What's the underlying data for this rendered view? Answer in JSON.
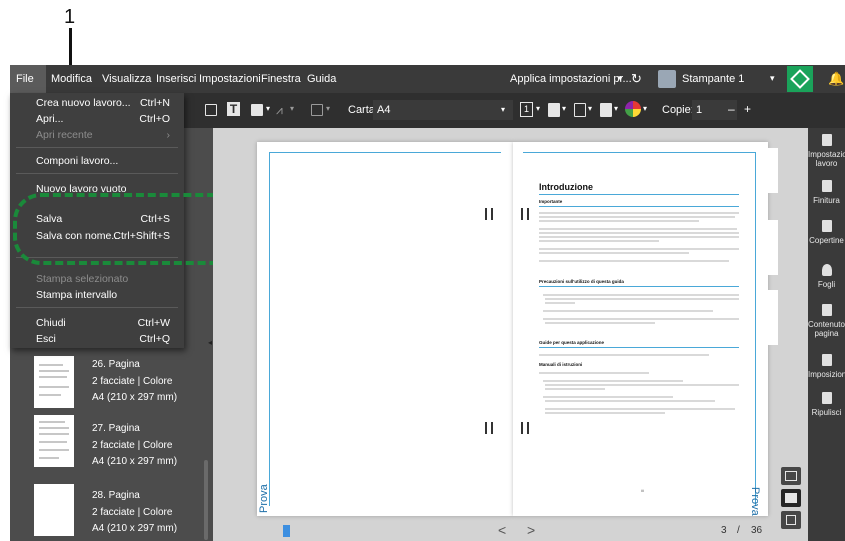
{
  "callout": {
    "number": "1"
  },
  "menubar": {
    "items": [
      "File",
      "Modifica",
      "Visualizza",
      "Inserisci",
      "Impostazioni",
      "Finestra",
      "Guida"
    ],
    "apply_settings": "Applica impostazioni pr...",
    "printer": "Stampante 1"
  },
  "toolbar": {
    "paper_label": "Carta:",
    "paper_value": "A4",
    "page_number_box": "1",
    "copies_label": "Copie:",
    "copies_value": "1",
    "minus": "–",
    "plus": "+"
  },
  "file_menu": {
    "items": [
      {
        "label": "Crea nuovo lavoro...",
        "shortcut": "Ctrl+N",
        "enabled": true
      },
      {
        "label": "Apri...",
        "shortcut": "Ctrl+O",
        "enabled": true
      },
      {
        "label": "Apri recente",
        "shortcut": "›",
        "enabled": false
      },
      {
        "label": "Componi lavoro...",
        "shortcut": "",
        "enabled": true
      },
      {
        "label": "Nuovo lavoro vuoto",
        "shortcut": "",
        "enabled": true
      },
      {
        "label": "Salva",
        "shortcut": "Ctrl+S",
        "enabled": true
      },
      {
        "label": "Salva con nome...",
        "shortcut": "Ctrl+Shift+S",
        "enabled": true
      },
      {
        "label": "Stampa selezionato",
        "shortcut": "",
        "enabled": false
      },
      {
        "label": "Stampa intervallo",
        "shortcut": "",
        "enabled": true
      },
      {
        "label": "Chiudi",
        "shortcut": "Ctrl+W",
        "enabled": true
      },
      {
        "label": "Esci",
        "shortcut": "Ctrl+Q",
        "enabled": true
      }
    ]
  },
  "thumbnails": [
    {
      "title": "26. Pagina",
      "sides": "2 facciate | Colore",
      "size": "A4 (210 x 297 mm)"
    },
    {
      "title": "27. Pagina",
      "sides": "2 facciate | Colore",
      "size": "A4 (210 x 297 mm)"
    },
    {
      "title": "28. Pagina",
      "sides": "2 facciate | Colore",
      "size": "A4 (210 x 297 mm)"
    }
  ],
  "document": {
    "watermark": "Prova",
    "heading": "Introduzione",
    "sections": [
      "Importante",
      "Precauzioni sull'utilizzo di questa guida",
      "Guide per questa applicazione",
      "Manuali di istruzioni"
    ],
    "page_number": "iii"
  },
  "pagination": {
    "current": "3",
    "separator": "/",
    "total": "36",
    "prev": "<",
    "next": ">"
  },
  "right_panel": {
    "items": [
      "Impostazioni lavoro",
      "Finitura",
      "Copertine",
      "Fogli",
      "Contenuto pagina",
      "Imposizione",
      "Ripulisci"
    ]
  },
  "colors": {
    "accent_green": "#1a8a3a",
    "menubar": "#3a3a3a",
    "canvas": "#d3d3d3",
    "rule_blue": "#4aa8d8",
    "bookmark_blue": "#3d8fe0"
  }
}
